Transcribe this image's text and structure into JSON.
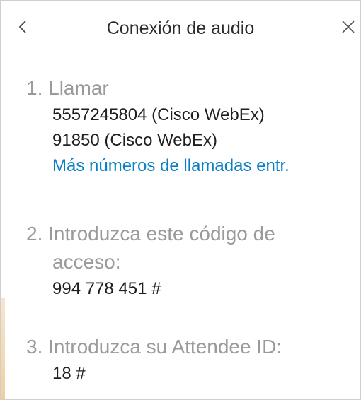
{
  "header": {
    "title": "Conexión de audio",
    "back_glyph": "<",
    "close_glyph": "✕"
  },
  "steps": {
    "call": {
      "number": "1.",
      "label": "Llamar",
      "numbers": [
        "5557245804 (Cisco WebEx)",
        "91850 (Cisco WebEx)"
      ],
      "more_link": "Más números de llamadas entr."
    },
    "access": {
      "number": "2.",
      "label_line1": "Introduzca este código de",
      "label_line2": "acceso:",
      "code": "994 778 451 #"
    },
    "attendee": {
      "number": "3.",
      "label": "Introduzca su Attendee ID:",
      "id": "18 #"
    }
  },
  "colors": {
    "link": "#0a7fc4",
    "muted": "#9a9a9a",
    "text": "#1f1f1f"
  }
}
